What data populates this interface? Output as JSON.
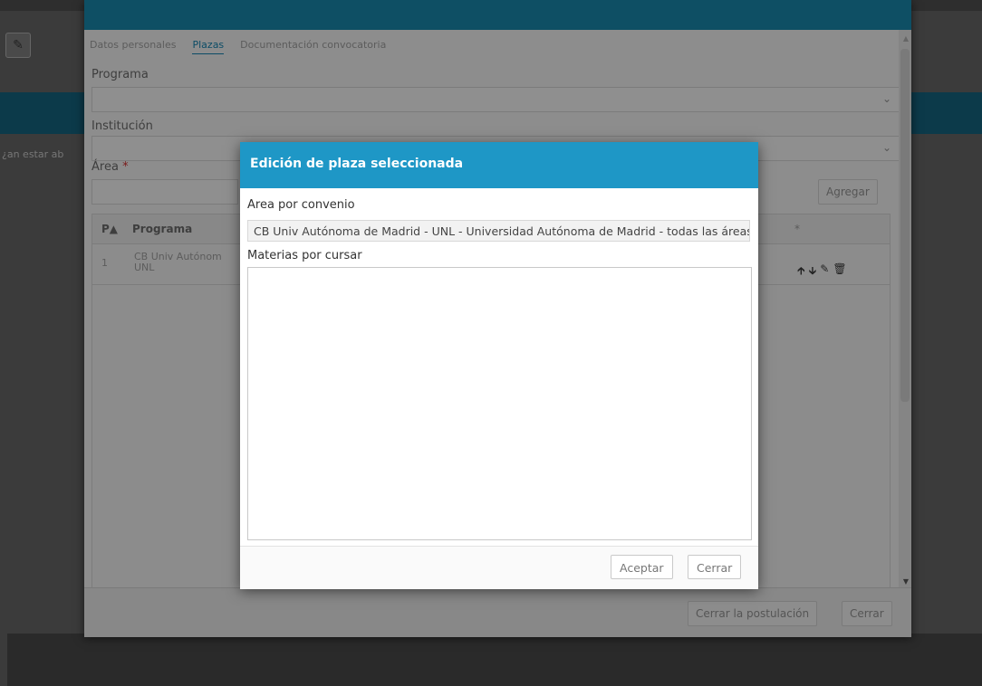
{
  "background_app": {
    "side_text": "¿an estar ab"
  },
  "back_dialog": {
    "tabs": [
      {
        "label": "Datos personales"
      },
      {
        "label": "Plazas"
      },
      {
        "label": "Documentación convocatoria"
      }
    ],
    "active_tab": "Plazas",
    "fields": {
      "programa_label": "Programa",
      "institucion_label": "Institución",
      "area_label": "Área",
      "required_mark": "*"
    },
    "agregar_label": "Agregar",
    "grid": {
      "columns": [
        "P",
        "Programa",
        "*"
      ],
      "rows": [
        {
          "p": "1",
          "programa": "CB Univ Autónom UNL"
        }
      ]
    },
    "footer": {
      "cerrar_postulacion_label": "Cerrar la postulación",
      "cerrar_label": "Cerrar"
    }
  },
  "modal": {
    "title": "Edición de plaza seleccionada",
    "area_label": "Area por convenio",
    "area_value": "CB Univ Autónoma de Madrid - UNL - Universidad Autónoma de Madrid - todas las áreas",
    "materias_label": "Materias por cursar",
    "materias_value": "",
    "aceptar_label": "Aceptar",
    "cerrar_label": "Cerrar"
  },
  "icons": {
    "chevron": "chevron-down-icon",
    "row_actions": [
      "arrow-up-icon",
      "arrow-down-icon",
      "edit-icon",
      "trash-icon"
    ]
  }
}
